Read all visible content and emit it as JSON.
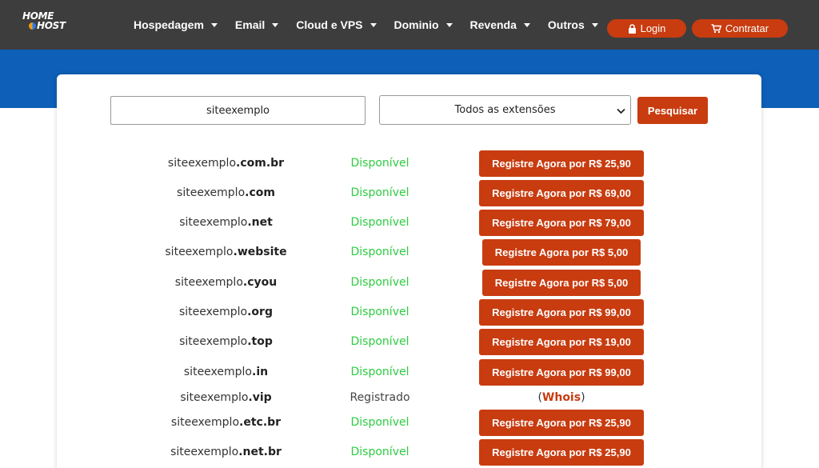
{
  "header": {
    "logo_line1": "HOME",
    "logo_line2": "HOST",
    "nav": [
      {
        "label": "Hospedagem"
      },
      {
        "label": "Email"
      },
      {
        "label": "Cloud e VPS"
      },
      {
        "label": "Dominio"
      },
      {
        "label": "Revenda"
      },
      {
        "label": "Outros"
      }
    ],
    "login_label": "Login",
    "contratar_label": "Contratar"
  },
  "search": {
    "value": "siteexemplo",
    "select_value": "Todos as extensões",
    "button_label": "Pesquisar"
  },
  "colors": {
    "header_bg": "#3d3d3d",
    "band_blue": "#0d5fb8",
    "accent": "#c83c10",
    "available": "#2ecc40"
  },
  "results": [
    {
      "name": "siteexemplo",
      "ext": ".com.br",
      "status": "Disponível",
      "action": "Registre Agora por R$ 25,90"
    },
    {
      "name": "siteexemplo",
      "ext": ".com",
      "status": "Disponível",
      "action": "Registre Agora por R$ 69,00"
    },
    {
      "name": "siteexemplo",
      "ext": ".net",
      "status": "Disponível",
      "action": "Registre Agora por R$ 79,00"
    },
    {
      "name": "siteexemplo",
      "ext": ".website",
      "status": "Disponível",
      "action": "Registre Agora por R$ 5,00"
    },
    {
      "name": "siteexemplo",
      "ext": ".cyou",
      "status": "Disponível",
      "action": "Registre Agora por R$ 5,00"
    },
    {
      "name": "siteexemplo",
      "ext": ".org",
      "status": "Disponível",
      "action": "Registre Agora por R$ 99,00"
    },
    {
      "name": "siteexemplo",
      "ext": ".top",
      "status": "Disponível",
      "action": "Registre Agora por R$ 19,00"
    },
    {
      "name": "siteexemplo",
      "ext": ".in",
      "status": "Disponível",
      "action": "Registre Agora por R$ 99,00"
    },
    {
      "name": "siteexemplo",
      "ext": ".vip",
      "status": "Registrado",
      "whois_open": "(",
      "whois_label": "Whois",
      "whois_close": ")"
    },
    {
      "name": "siteexemplo",
      "ext": ".etc.br",
      "status": "Disponível",
      "action": "Registre Agora por R$ 25,90"
    },
    {
      "name": "siteexemplo",
      "ext": ".net.br",
      "status": "Disponível",
      "action": "Registre Agora por R$ 25,90"
    }
  ]
}
